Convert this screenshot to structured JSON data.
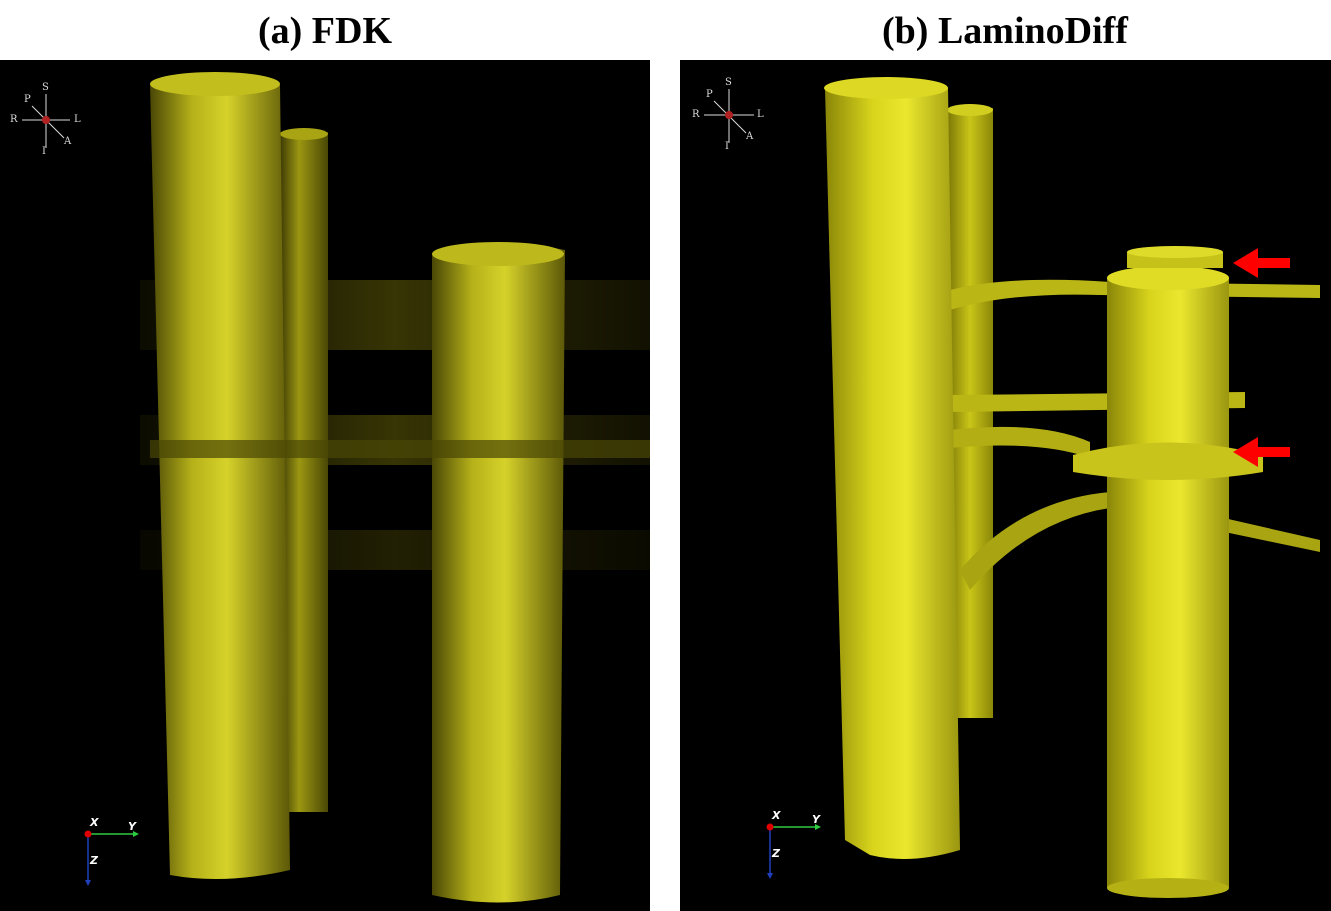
{
  "panels": [
    {
      "title": "(a) FDK",
      "orientation": {
        "superior": "S",
        "posterior": "P",
        "right": "R",
        "left": "L",
        "anterior": "A",
        "inferior": "I"
      },
      "axes": {
        "x": "X",
        "y": "Y",
        "z": "Z"
      }
    },
    {
      "title": "(b) LaminoDiff",
      "orientation": {
        "superior": "S",
        "posterior": "P",
        "right": "R",
        "left": "L",
        "anterior": "A",
        "inferior": "I"
      },
      "axes": {
        "x": "X",
        "y": "Y",
        "z": "Z"
      }
    }
  ],
  "colors": {
    "volume": "#c8c41a",
    "volume_dark": "#6e6a08",
    "arrow": "#ff0000",
    "background": "#000000"
  },
  "icons": [
    "orientation-cube-icon",
    "axis-triad-icon",
    "red-arrow-icon"
  ]
}
